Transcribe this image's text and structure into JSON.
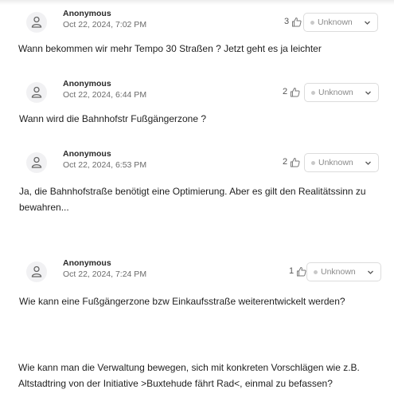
{
  "comments": [
    {
      "author": "Anonymous",
      "date": "Oct 22, 2024, 7:02 PM",
      "likes": "3",
      "status": "Unknown",
      "text": "Wann bekommen wir mehr Tempo 30 Straßen ? Jetzt geht es ja leichter"
    },
    {
      "author": "Anonymous",
      "date": "Oct 22, 2024, 6:44 PM",
      "likes": "2",
      "status": "Unknown",
      "text": "Wann wird die Bahnhofstr Fußgängerzone ?"
    },
    {
      "author": "Anonymous",
      "date": "Oct 22, 2024, 6:53 PM",
      "likes": "2",
      "status": "Unknown",
      "text": "Ja, die Bahnhofstraße benötigt eine Optimierung. Aber es gilt den Realitätssinn zu bewahren..."
    },
    {
      "author": "Anonymous",
      "date": "Oct 22, 2024, 7:24 PM",
      "likes": "1",
      "status": "Unknown",
      "text": "Wie kann eine Fußgängerzone bzw Einkaufsstraße weiterentwickelt werden?"
    }
  ],
  "trailing_text": "Wie kann man die Verwaltung bewegen, sich mit konkreten Vorschlägen wie z.B. Altstadtring von der Initiative >Buxtehude fährt Rad<, einmal zu befassen?",
  "icons": {
    "avatar": "user-icon",
    "like": "thumbs-up-icon",
    "dropdown": "chevron-down-icon"
  },
  "colors": {
    "text": "#1f1f1f",
    "muted": "#6b6b6b",
    "border": "#dcdcdc"
  }
}
